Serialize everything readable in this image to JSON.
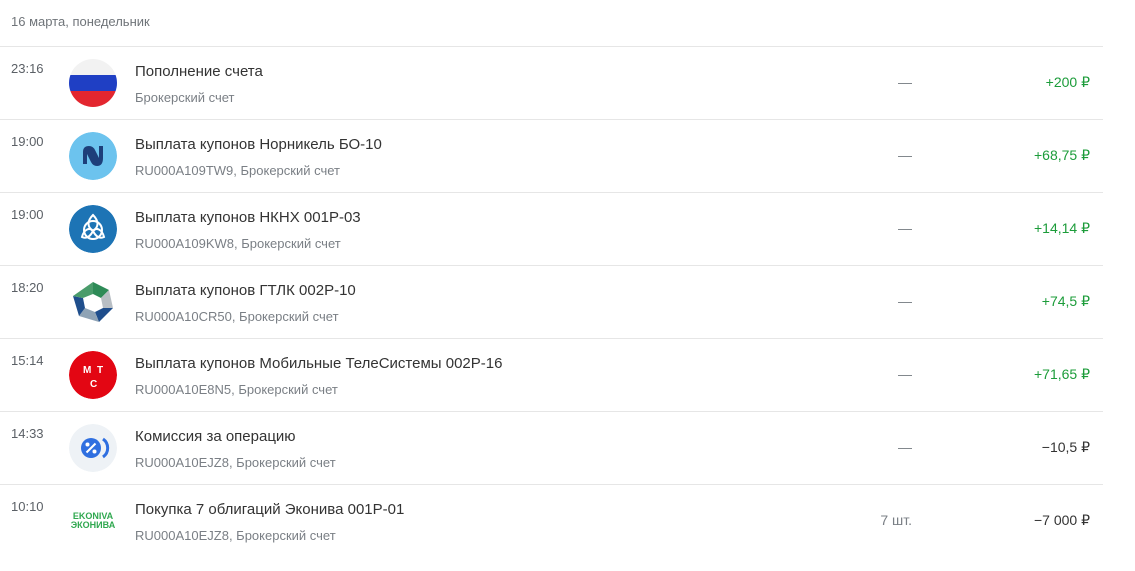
{
  "date_header": "16 марта, понедельник",
  "colors": {
    "positive": "#1c9c3a",
    "negative": "#333333"
  },
  "operations": [
    {
      "time": "23:16",
      "icon": "russia-flag-icon",
      "title": "Пополнение счета",
      "subtitle": "Брокерский счет",
      "quantity": "—",
      "amount": "+200 ₽"
    },
    {
      "time": "19:00",
      "icon": "nornickel-logo-icon",
      "title": "Выплата купонов Норникель БО-10",
      "subtitle": "RU000A109TW9, Брокерский счет",
      "quantity": "—",
      "amount": "+68,75 ₽"
    },
    {
      "time": "19:00",
      "icon": "nknh-logo-icon",
      "title": "Выплата купонов НКНХ 001Р-03",
      "subtitle": "RU000A109KW8, Брокерский счет",
      "quantity": "—",
      "amount": "+14,14 ₽"
    },
    {
      "time": "18:20",
      "icon": "gtlk-logo-icon",
      "title": "Выплата купонов ГТЛК 002Р-10",
      "subtitle": "RU000A10CR50, Брокерский счет",
      "quantity": "—",
      "amount": "+74,5 ₽"
    },
    {
      "time": "15:14",
      "icon": "mts-logo-icon",
      "title": "Выплата купонов Мобильные ТелеСистемы 002Р-16",
      "subtitle": "RU000A10E8N5, Брокерский счет",
      "quantity": "—",
      "amount": "+71,65 ₽"
    },
    {
      "time": "14:33",
      "icon": "commission-percent-icon",
      "title": "Комиссия за операцию",
      "subtitle": "RU000A10EJZ8, Брокерский счет",
      "quantity": "—",
      "amount": "−10,5 ₽"
    },
    {
      "time": "10:10",
      "icon": "ekoniva-logo-icon",
      "logo_text_top": "EKONIVA",
      "logo_text_bottom": "ЭКОНИВА",
      "title": "Покупка 7 облигаций Эконива 001Р-01",
      "subtitle": "RU000A10EJZ8, Брокерский счет",
      "quantity": "7 шт.",
      "amount": "−7 000 ₽"
    }
  ]
}
